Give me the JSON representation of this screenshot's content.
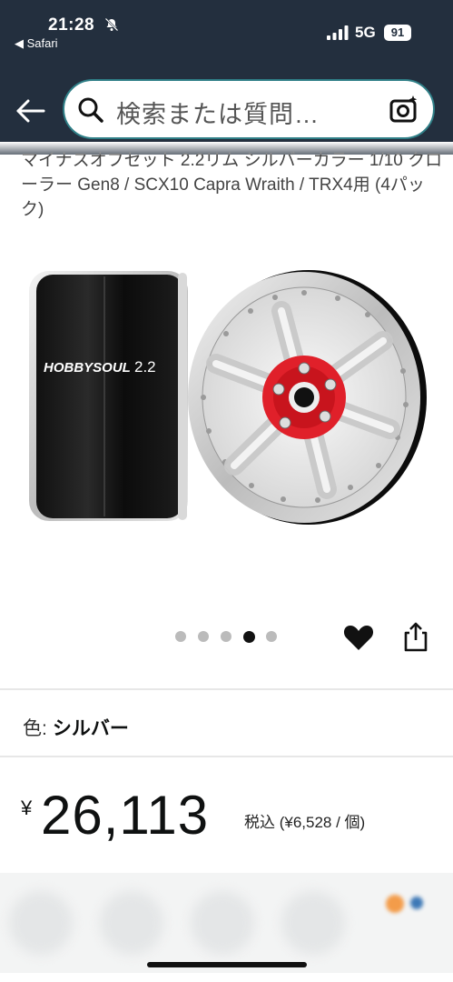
{
  "status": {
    "time": "21:28",
    "back_app": "◀ Safari",
    "network": "5G",
    "battery": "91"
  },
  "search": {
    "placeholder": "検索または質問…"
  },
  "product": {
    "title": "マイナスオフセット 2.2リム シルバーカラー 1/10 クローラー Gen8 / SCX10 Capra Wraith / TRX4用 (4パック)",
    "brand_on_wheel": "HOBBYSOUL 2.2",
    "image_count": 5,
    "active_image": 4
  },
  "variant": {
    "label": "色:",
    "value": "シルバー"
  },
  "price": {
    "currency": "¥",
    "amount": "26,113",
    "tax_note": "税込 (¥6,528 / 個)"
  },
  "icons": {
    "heart": "heart-icon",
    "share": "share-icon",
    "camera": "camera-icon",
    "search": "search-icon",
    "back": "back-arrow-icon"
  },
  "colors": {
    "header_bg": "#232f3e",
    "search_border": "#2f7f87",
    "wheel_red": "#e0202a"
  }
}
